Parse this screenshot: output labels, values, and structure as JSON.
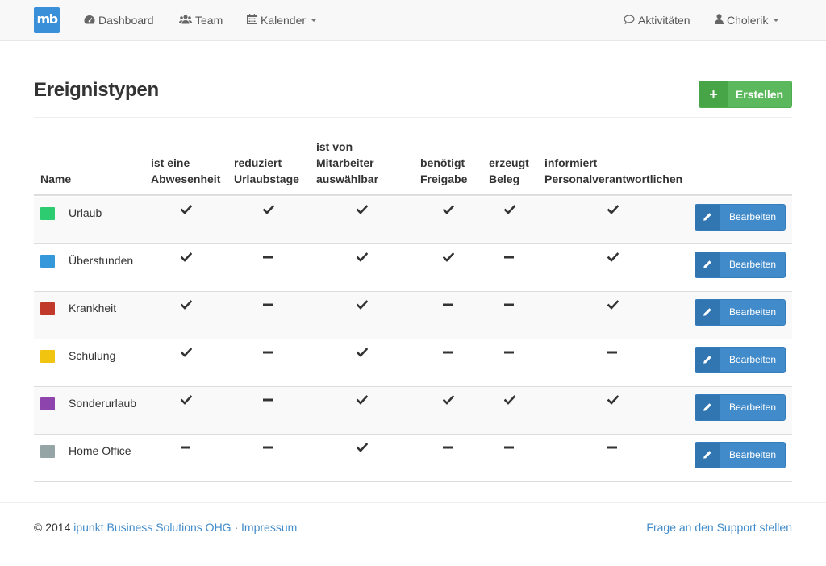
{
  "navbar": {
    "brand": "mb",
    "items": [
      {
        "label": "Dashboard",
        "icon": "dashboard-icon"
      },
      {
        "label": "Team",
        "icon": "users-icon"
      },
      {
        "label": "Kalender",
        "icon": "calendar-icon"
      },
      {
        "label": "Aktivitäten",
        "icon": "comment-icon"
      },
      {
        "label": "Cholerik",
        "icon": "user-icon"
      }
    ]
  },
  "page": {
    "title": "Ereignistypen",
    "create_label": "Erstellen"
  },
  "table": {
    "headers": [
      {
        "lines": [
          "Name"
        ]
      },
      {
        "lines": [
          "ist eine",
          "Abwesenheit"
        ]
      },
      {
        "lines": [
          "reduziert",
          "Urlaubstage"
        ]
      },
      {
        "lines": [
          "ist von",
          "Mitarbeiter",
          "auswählbar"
        ]
      },
      {
        "lines": [
          "benötigt",
          "Freigabe"
        ]
      },
      {
        "lines": [
          "erzeugt",
          "Beleg"
        ]
      },
      {
        "lines": [
          "informiert",
          "Personalverantwortlichen"
        ]
      }
    ],
    "edit_label": "Bearbeiten",
    "rows": [
      {
        "name": "Urlaub",
        "color": "#2ecc71",
        "flags": [
          true,
          true,
          true,
          true,
          true,
          true
        ]
      },
      {
        "name": "Überstunden",
        "color": "#3498db",
        "flags": [
          true,
          false,
          true,
          true,
          false,
          true
        ]
      },
      {
        "name": "Krankheit",
        "color": "#c0392b",
        "flags": [
          true,
          false,
          true,
          false,
          false,
          true
        ]
      },
      {
        "name": "Schulung",
        "color": "#f1c40f",
        "flags": [
          true,
          false,
          true,
          false,
          false,
          false
        ]
      },
      {
        "name": "Sonderurlaub",
        "color": "#8e44ad",
        "flags": [
          true,
          false,
          true,
          true,
          true,
          true
        ]
      },
      {
        "name": "Home Office",
        "color": "#95a5a6",
        "flags": [
          false,
          false,
          true,
          false,
          false,
          false
        ]
      }
    ]
  },
  "footer": {
    "copyright": "© 2014",
    "company": "ipunkt Business Solutions OHG",
    "separator": "·",
    "impressum": "Impressum",
    "support": "Frage an den Support stellen"
  }
}
